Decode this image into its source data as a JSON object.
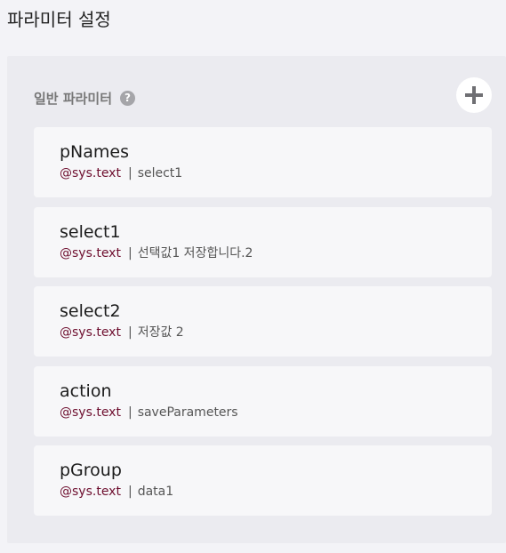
{
  "page": {
    "title": "파라미터 설정"
  },
  "section": {
    "title": "일반 파라미터",
    "help_icon": "question-circle-icon",
    "add_icon": "plus-icon"
  },
  "parameters": [
    {
      "name": "pNames",
      "type": "@sys.text",
      "separator": "|",
      "value": "select1"
    },
    {
      "name": "select1",
      "type": "@sys.text",
      "separator": "|",
      "value": "선택값1 저장합니다.2"
    },
    {
      "name": "select2",
      "type": "@sys.text",
      "separator": "|",
      "value": "저장값 2"
    },
    {
      "name": "action",
      "type": "@sys.text",
      "separator": "|",
      "value": "saveParameters"
    },
    {
      "name": "pGroup",
      "type": "@sys.text",
      "separator": "|",
      "value": "data1"
    }
  ],
  "colors": {
    "type_text": "#6e0f2f",
    "page_bg": "#f3f3f7",
    "panel_bg": "#ebebf0",
    "card_bg": "#f7f7f9"
  }
}
